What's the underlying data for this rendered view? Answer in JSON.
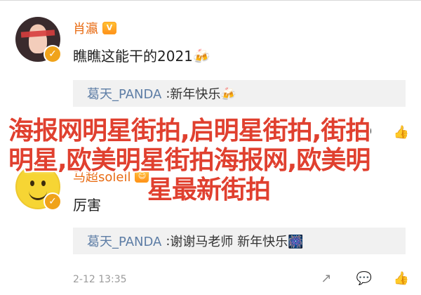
{
  "comments": [
    {
      "user": "肖瀛",
      "badge": "V",
      "content": "瞧瞧这能干的2021🍻",
      "reply": {
        "user": "葛天_PANDA",
        "text": "新年快乐🍻"
      }
    },
    {
      "user": "马超soleil",
      "badge": "☺",
      "content": "厉害",
      "reply": {
        "user": "葛天_PANDA",
        "text": "谢谢马老师 新年快乐🎆"
      },
      "meta": "2-12 13:35"
    }
  ],
  "actions": {
    "share": "↗",
    "comment": "💬",
    "like": "👍"
  },
  "overlay": {
    "line1": "海报网明星街拍,启明星街拍,街拍",
    "line2": "明星,欧美明星街拍海报网,欧美明",
    "line3": "星最新街拍"
  },
  "colors": {
    "username": "#e86b13",
    "reply_user": "#5d7da5",
    "overlay_text": "#e0402f"
  },
  "icons": {
    "verify": "verified-badge-icon",
    "avatar1": "avatar",
    "avatar2": "avatar"
  }
}
